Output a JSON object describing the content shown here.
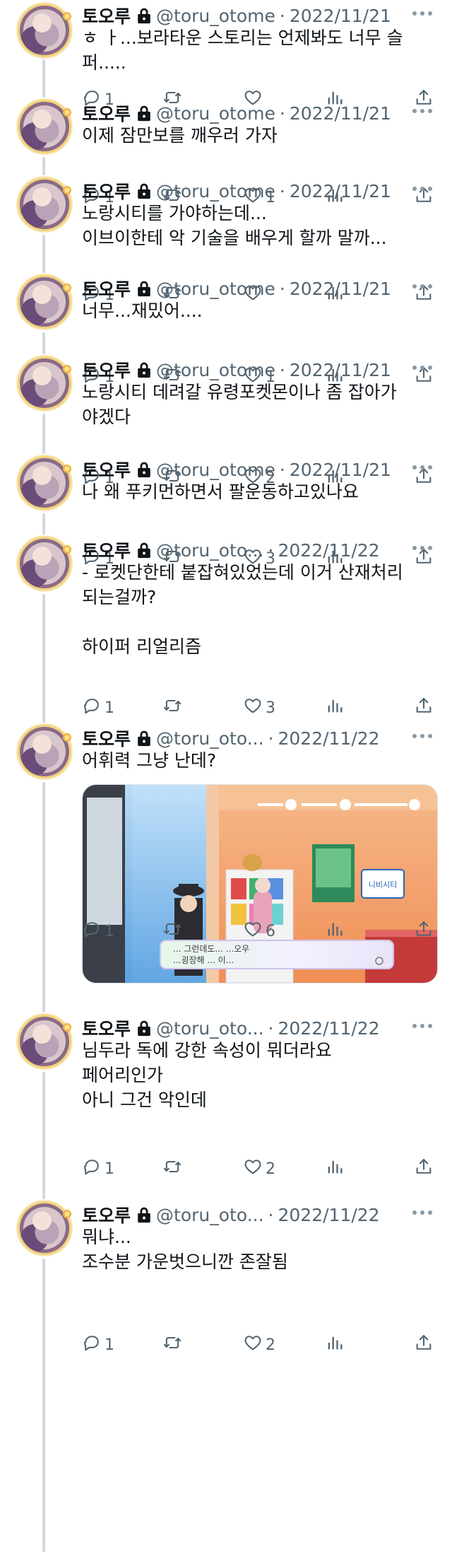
{
  "profile": {
    "name": "토오루",
    "handle_full": "@toru_otome",
    "handle_short": "@toru_oto...",
    "separator": "·"
  },
  "tweets": [
    {
      "date": "2022/11/21",
      "text": "ㅎ ㅏ...보라타운 스토리는 언제봐도 너무 슬\n퍼.....",
      "replies": "1",
      "retweets": "",
      "likes": ""
    },
    {
      "date": "2022/11/21",
      "text": "이제 잠만보를 깨우러 가자",
      "replies": "1",
      "retweets": "",
      "likes": "1"
    },
    {
      "date": "2022/11/21",
      "text": "노랑시티를 가야하는데...\n이브이한테 악 기술을 배우게 할까 말까...",
      "replies": "1",
      "retweets": "",
      "likes": ""
    },
    {
      "date": "2022/11/21",
      "text": "너무...재밌어....",
      "replies": "1",
      "retweets": "",
      "likes": "1"
    },
    {
      "date": "2022/11/21",
      "text": "노랑시티 데려갈 유령포켓몬이나 좀 잡아가\n야겠다",
      "replies": "1",
      "retweets": "",
      "likes": "2"
    },
    {
      "date": "2022/11/21",
      "text": "나 왜 푸키먼하면서 팔운동하고있나요",
      "replies": "1",
      "retweets": "",
      "likes": "3"
    },
    {
      "date": "2022/11/22",
      "text": "- 로켓단한테 붙잡혀있었는데 이거 산재처리\n되는걸까?\n\n하이퍼 리얼리즘",
      "replies": "1",
      "retweets": "",
      "likes": "3"
    },
    {
      "date": "2022/11/22",
      "text": "어휘력 그냥 난데?",
      "replies": "1",
      "retweets": "",
      "likes": "6",
      "media": {
        "dialog_line1": "... 그런데도... ...오우",
        "dialog_line2": "...굉장해 ... 이...",
        "sign_text": "니비시티"
      }
    },
    {
      "date": "2022/11/22",
      "text": "님두라 독에 강한 속성이 뭐더라요\n페어리인가\n아니 그건 악인데",
      "replies": "1",
      "retweets": "",
      "likes": "2"
    },
    {
      "date": "2022/11/22",
      "text": "뭐냐...\n조수분 가운벗으니깐 존잘됨",
      "replies": "1",
      "retweets": "",
      "likes": "2"
    }
  ],
  "icons": {
    "reply": "reply-icon",
    "retweet": "retweet-icon",
    "like": "heart-icon",
    "views": "views-icon",
    "share": "share-icon",
    "lock": "lock-icon",
    "more": "more-icon"
  },
  "colors": {
    "text": "#0f1419",
    "muted": "#536471",
    "thread": "#cfd9de"
  }
}
